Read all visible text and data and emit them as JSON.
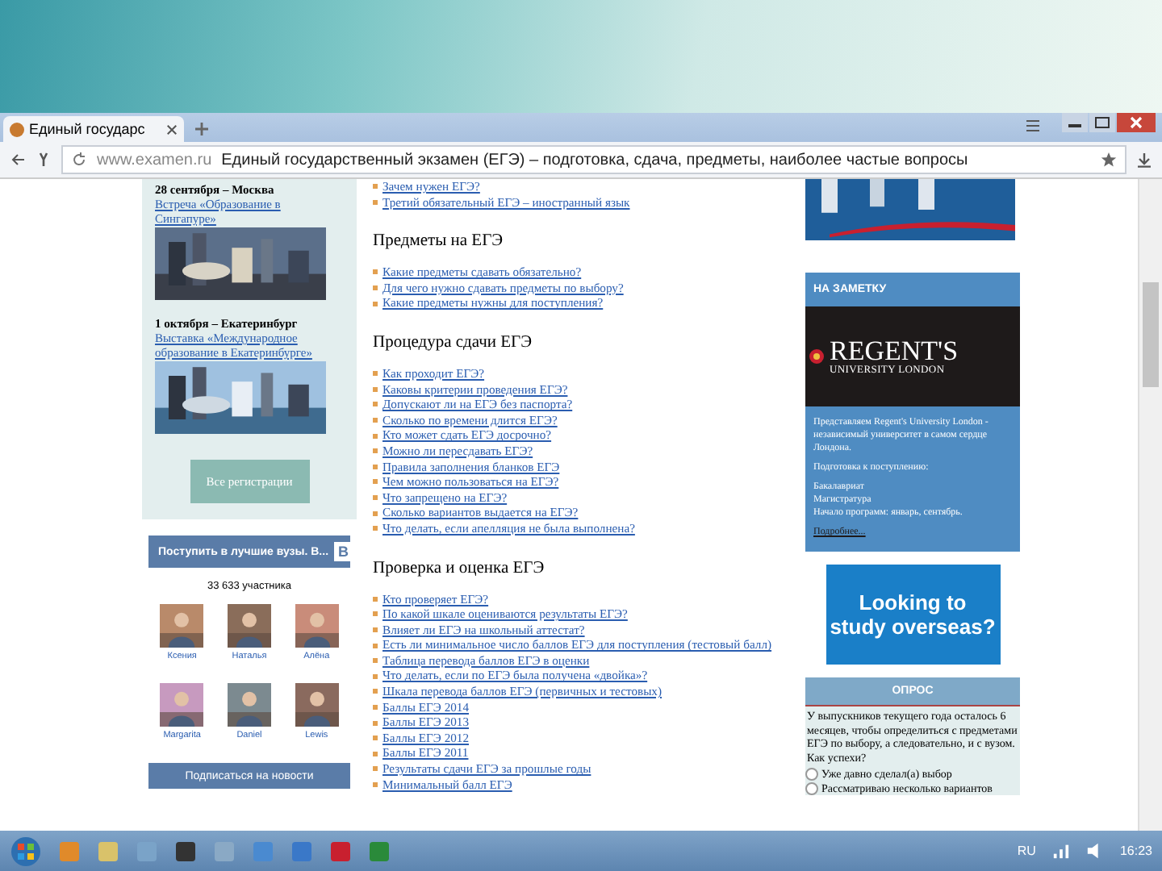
{
  "browser": {
    "tab_title": "Единый государс",
    "url": "www.examen.ru",
    "page_title": "Единый государственный экзамен (ЕГЭ) – подготовка, сдача, предметы, наиболее частые вопросы"
  },
  "events": [
    {
      "date": "28 сентября – Москва",
      "link": "Встреча «Образование в Сингапуре»"
    },
    {
      "date": "1 октября – Екатеринбург",
      "link": "Выставка «Международное образование в Екатеринбурге»"
    }
  ],
  "all_events_button": "Все регистрации",
  "vk_widget": {
    "title": "Поступить в лучшие вузы. В...",
    "logo": "В",
    "members": "33 633 участника",
    "people": [
      "Ксения",
      "Наталья",
      "Алёна",
      "Margarita",
      "Daniel",
      "Lewis"
    ],
    "subscribe_button": "Подписаться на новости"
  },
  "top_links": [
    "Зачем нужен ЕГЭ?",
    "Третий обязательный ЕГЭ – иностранный язык"
  ],
  "sections": [
    {
      "heading": "Предметы на ЕГЭ",
      "links": [
        "Какие предметы сдавать обязательно?",
        "Для чего нужно сдавать предметы по выбору?",
        "Какие предметы нужны для поступления?"
      ]
    },
    {
      "heading": "Процедура сдачи ЕГЭ",
      "links": [
        "Как проходит ЕГЭ?",
        "Каковы критерии проведения ЕГЭ?",
        "Допускают ли на ЕГЭ без паспорта?",
        "Сколько по времени длится ЕГЭ?",
        "Кто может сдать ЕГЭ досрочно?",
        "Можно ли пересдавать ЕГЭ?",
        "Правила заполнения бланков ЕГЭ",
        "Чем можно пользоваться на ЕГЭ?",
        "Что запрещено на ЕГЭ?",
        "Сколько вариантов выдается на ЕГЭ?",
        "Что делать, если апелляция не была выполнена?"
      ]
    },
    {
      "heading": "Проверка и оценка ЕГЭ",
      "links": [
        "Кто проверяет ЕГЭ?",
        "По какой шкале оцениваются результаты ЕГЭ?",
        "Влияет ли ЕГЭ на школьный аттестат?",
        "Есть ли минимальное число баллов ЕГЭ для поступления (тестовый балл)",
        "Таблица перевода баллов ЕГЭ в оценки",
        "Что делать, если по ЕГЭ была получена «двойка»?",
        "Шкала перевода баллов ЕГЭ (первичных и тестовых)",
        "Баллы ЕГЭ 2014",
        "Баллы ЕГЭ 2013",
        "Баллы ЕГЭ 2012",
        "Баллы ЕГЭ 2011",
        "Результаты сдачи ЕГЭ за прошлые годы",
        "Минимальный балл ЕГЭ"
      ]
    }
  ],
  "note_panel": {
    "title": "НА ЗАМЕТКУ",
    "logo_name": "REGENT'S",
    "logo_sub": "UNIVERSITY LONDON",
    "paragraphs": [
      "Представляем Regent's University London - независимый университет в самом сердце Лондона.",
      "Подготовка к поступлению:",
      "Бакалавриат",
      "Магистратура",
      "Начало программ: январь, сентябрь."
    ],
    "more_link": "Подробнее..."
  },
  "ad": {
    "lines": [
      "Looking to",
      "study overseas?"
    ]
  },
  "poll": {
    "title": "ОПРОС",
    "question": "У выпускников текущего года осталось 6 месяцев, чтобы определиться с предметами ЕГЭ по выбору, а следовательно, и с вузом. Как успехи?",
    "options": [
      {
        "label": "Уже давно сделал(а) выбор",
        "selected": false
      },
      {
        "label": "Рассматриваю несколько вариантов",
        "selected": false
      }
    ]
  },
  "taskbar": {
    "language": "RU",
    "time": "16:23"
  }
}
